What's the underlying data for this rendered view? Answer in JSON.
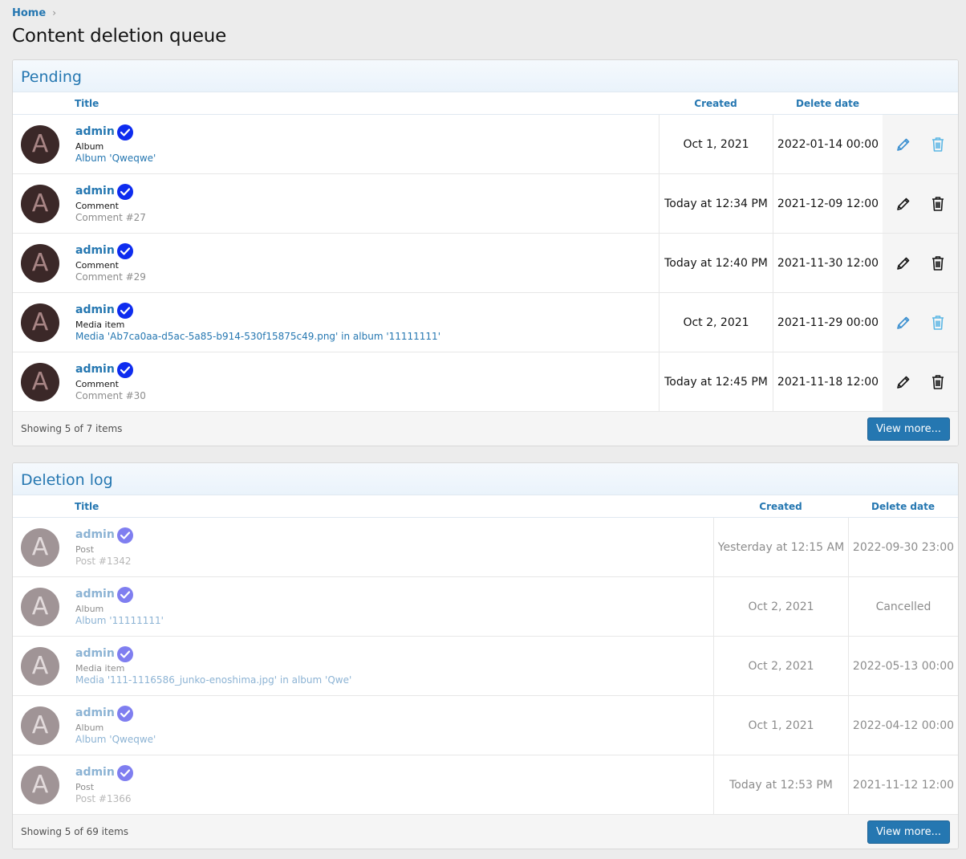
{
  "breadcrumb": {
    "home": "Home"
  },
  "title": "Content deletion queue",
  "pending": {
    "heading": "Pending",
    "columns": {
      "title": "Title",
      "created": "Created",
      "delete": "Delete date"
    },
    "rows": [
      {
        "avatar": "A",
        "user": "admin",
        "type": "Album",
        "link": "Album 'Qweqwe'",
        "link_muted": false,
        "created": "Oct 1, 2021",
        "delete": "2022-01-14 00:00",
        "actions_active": true
      },
      {
        "avatar": "A",
        "user": "admin",
        "type": "Comment",
        "link": "Comment #27",
        "link_muted": true,
        "created": "Today at 12:34 PM",
        "delete": "2021-12-09 12:00",
        "actions_active": false
      },
      {
        "avatar": "A",
        "user": "admin",
        "type": "Comment",
        "link": "Comment #29",
        "link_muted": true,
        "created": "Today at 12:40 PM",
        "delete": "2021-11-30 12:00",
        "actions_active": false
      },
      {
        "avatar": "A",
        "user": "admin",
        "type": "Media item",
        "link": "Media 'Ab7ca0aa-d5ac-5a85-b914-530f15875c49.png' in album '11111111'",
        "link_muted": false,
        "created": "Oct 2, 2021",
        "delete": "2021-11-29 00:00",
        "actions_active": true
      },
      {
        "avatar": "A",
        "user": "admin",
        "type": "Comment",
        "link": "Comment #30",
        "link_muted": true,
        "created": "Today at 12:45 PM",
        "delete": "2021-11-18 12:00",
        "actions_active": false
      }
    ],
    "footer": "Showing 5 of 7 items",
    "button": "View more..."
  },
  "log": {
    "heading": "Deletion log",
    "columns": {
      "title": "Title",
      "created": "Created",
      "delete": "Delete date"
    },
    "rows": [
      {
        "avatar": "A",
        "user": "admin",
        "type": "Post",
        "link": "Post #1342",
        "link_muted": true,
        "created": "Yesterday at 12:15 AM",
        "delete": "2022-09-30 23:00"
      },
      {
        "avatar": "A",
        "user": "admin",
        "type": "Album",
        "link": "Album '11111111'",
        "link_muted": false,
        "created": "Oct 2, 2021",
        "delete": "Cancelled"
      },
      {
        "avatar": "A",
        "user": "admin",
        "type": "Media item",
        "link": "Media '111-1116586_junko-enoshima.jpg' in album 'Qwe'",
        "link_muted": false,
        "created": "Oct 2, 2021",
        "delete": "2022-05-13 00:00"
      },
      {
        "avatar": "A",
        "user": "admin",
        "type": "Album",
        "link": "Album 'Qweqwe'",
        "link_muted": false,
        "created": "Oct 1, 2021",
        "delete": "2022-04-12 00:00"
      },
      {
        "avatar": "A",
        "user": "admin",
        "type": "Post",
        "link": "Post #1366",
        "link_muted": true,
        "created": "Today at 12:53 PM",
        "delete": "2021-11-12 12:00"
      }
    ],
    "footer": "Showing 5 of 69 items",
    "button": "View more..."
  },
  "colors": {
    "accent": "#2577b1",
    "verified": "#0e2cef",
    "action_active": "#3a8fd0",
    "action_inactive": "#141414"
  },
  "icons": {
    "edit": "pencil-icon",
    "delete": "trash-icon",
    "verified": "verified-check-icon",
    "breadcrumb_sep": "chevron-right-icon"
  }
}
